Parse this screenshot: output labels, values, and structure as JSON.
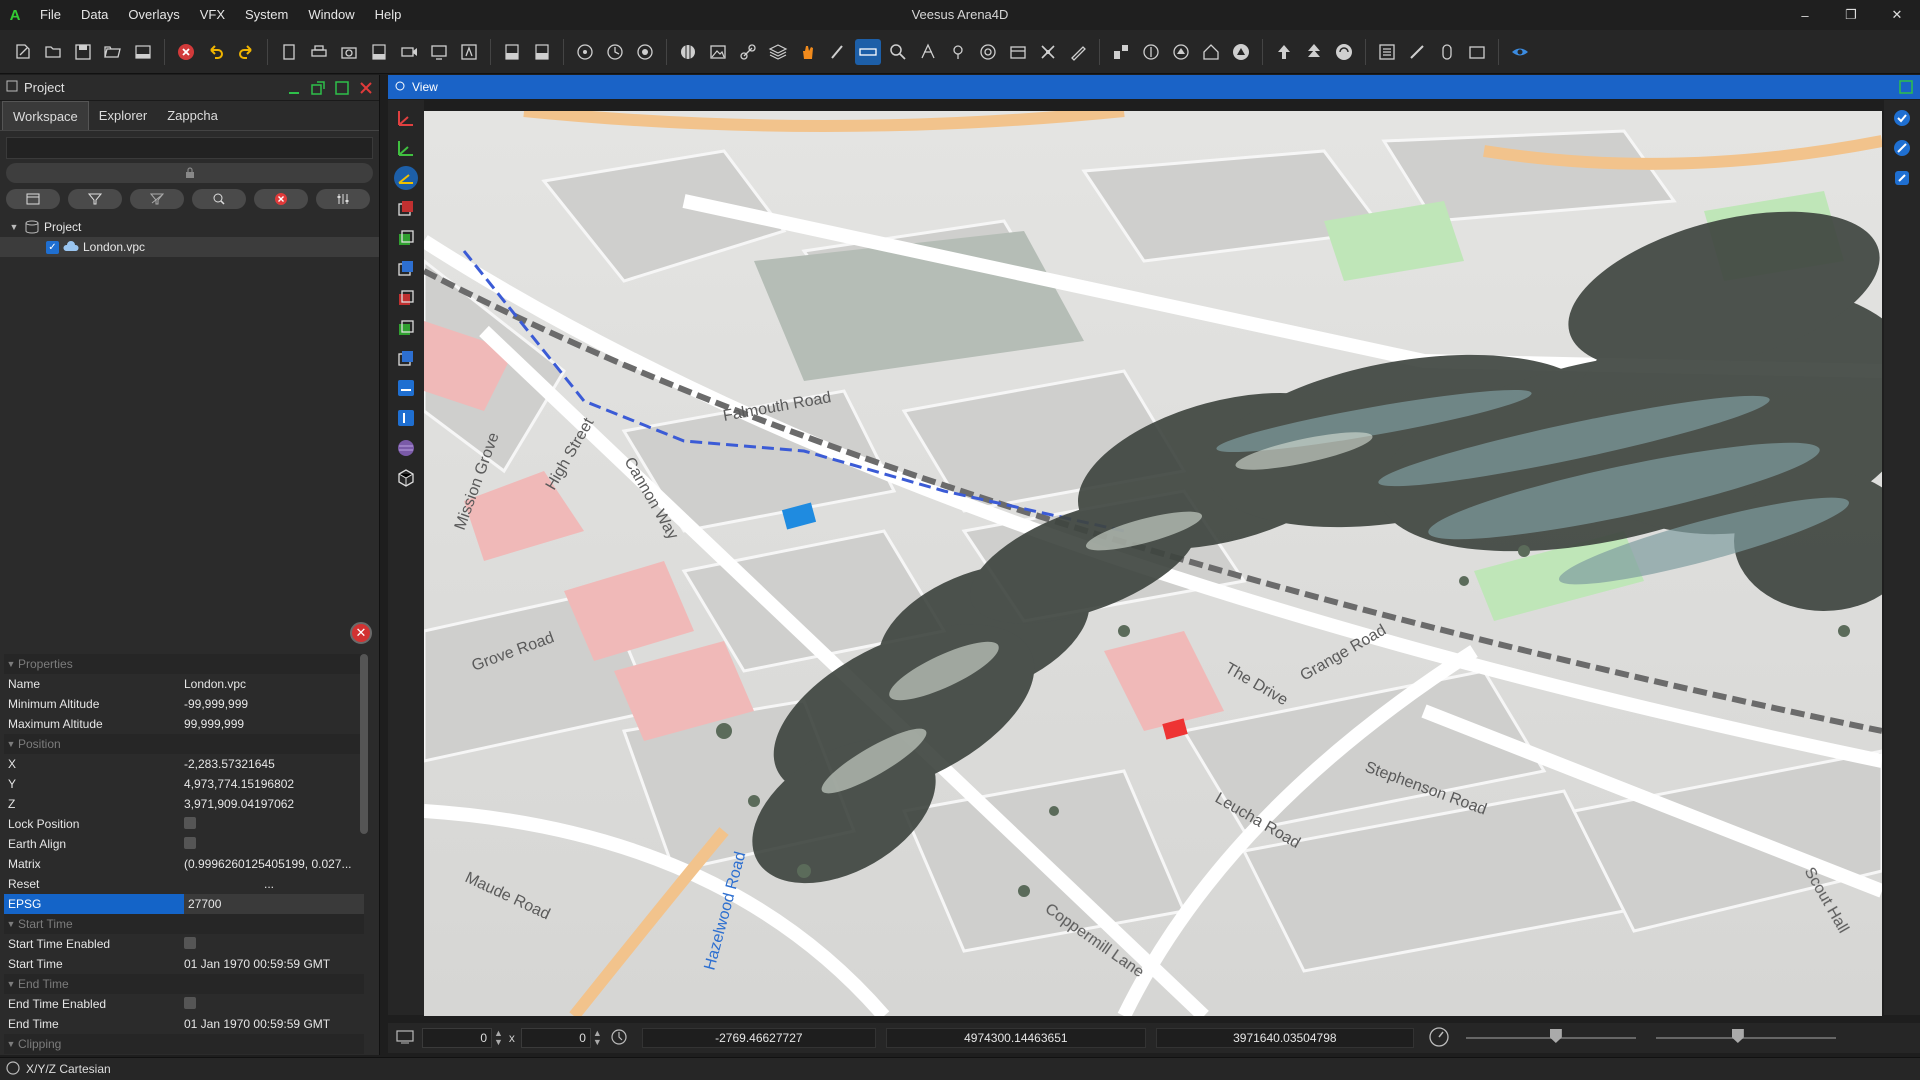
{
  "app": {
    "title": "Veesus Arena4D",
    "logo_letter": "A"
  },
  "menu": [
    "File",
    "Data",
    "Overlays",
    "VFX",
    "System",
    "Window",
    "Help"
  ],
  "project_panel": {
    "title": "Project",
    "tabs": [
      "Workspace",
      "Explorer",
      "Zappcha"
    ],
    "active_tab": "Workspace",
    "tree": [
      {
        "label": "Project",
        "expanded": true
      },
      {
        "label": "London.vpc",
        "checked": true
      }
    ]
  },
  "properties": {
    "groups": [
      {
        "title": "Properties",
        "rows": [
          {
            "key": "Name",
            "value": "London.vpc"
          },
          {
            "key": "Minimum Altitude",
            "value": "-99,999,999"
          },
          {
            "key": "Maximum Altitude",
            "value": "99,999,999"
          }
        ]
      },
      {
        "title": "Position",
        "rows": [
          {
            "key": "X",
            "value": "-2,283.57321645"
          },
          {
            "key": "Y",
            "value": "4,973,774.15196802"
          },
          {
            "key": "Z",
            "value": "3,971,909.04197062"
          },
          {
            "key": "Lock Position",
            "value": ""
          },
          {
            "key": "Earth Align",
            "value": ""
          },
          {
            "key": "Matrix",
            "value": "(0.9996260125405199, 0.027..."
          },
          {
            "key": "Reset",
            "value": "..."
          },
          {
            "key": "EPSG",
            "value": "27700"
          }
        ]
      },
      {
        "title": "Start Time",
        "rows": [
          {
            "key": "Start Time Enabled",
            "value": ""
          },
          {
            "key": "Start Time",
            "value": "01 Jan 1970 00:59:59 GMT"
          }
        ]
      },
      {
        "title": "End Time",
        "rows": [
          {
            "key": "End Time Enabled",
            "value": ""
          },
          {
            "key": "End Time",
            "value": "01 Jan 1970 00:59:59 GMT"
          }
        ]
      },
      {
        "title": "Clipping",
        "rows": []
      }
    ]
  },
  "view": {
    "title": "View",
    "map_labels": [
      "High Street",
      "Mission Grove",
      "Falmouth Road",
      "Cannon Way",
      "Stephenson Road",
      "Leucha Road",
      "Coppermill Lane",
      "Maude Road",
      "Hazelwood Road",
      "The Drive",
      "Grange Road",
      "Scout Hall",
      "Grove Road"
    ]
  },
  "coords": {
    "width_val": "0",
    "times_symbol": "x",
    "height_val": "0",
    "x": "-2769.46627727",
    "y": "4974300.14463651",
    "z": "3971640.03504798"
  },
  "status": {
    "mode": "X/Y/Z Cartesian"
  },
  "window_controls": [
    "–",
    "❐",
    "✕"
  ]
}
